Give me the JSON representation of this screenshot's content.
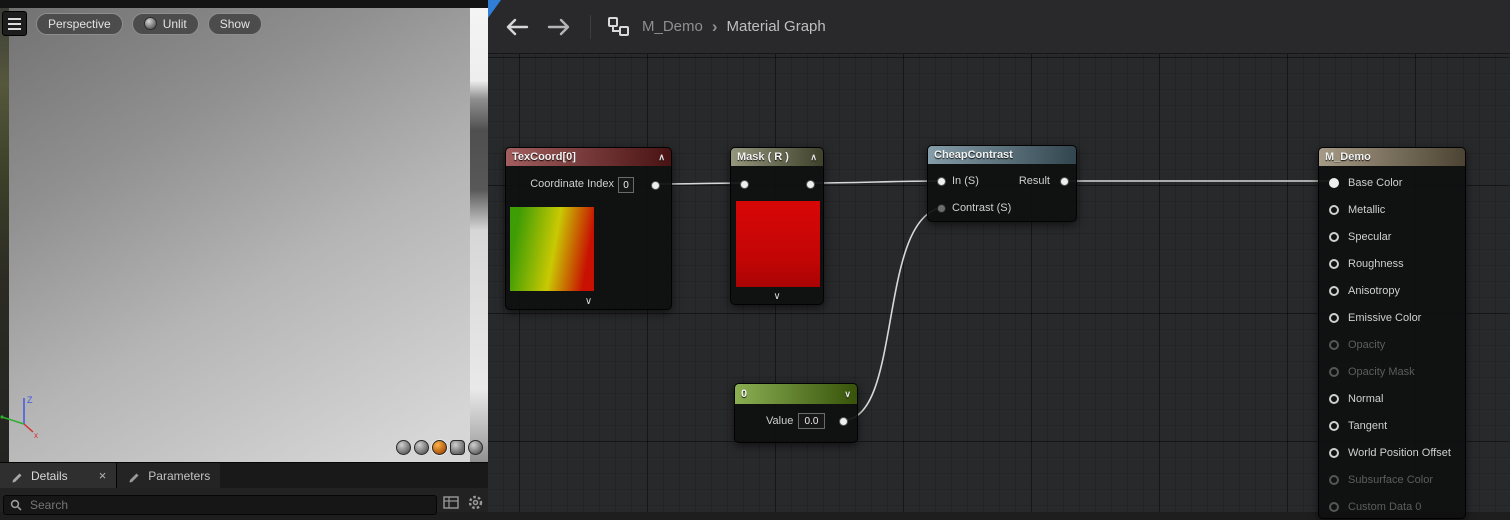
{
  "icons": {
    "close": "×",
    "chevron_up": "∧",
    "chevron_down": "∨",
    "breadcrumb_separator": "›"
  },
  "viewport": {
    "toolbar": {
      "perspective": "Perspective",
      "unlit": "Unlit",
      "show": "Show"
    },
    "gizmo_z_label": "Z",
    "gizmo_x_label": "x",
    "preview_meshes": [
      "cylinder",
      "sphere",
      "sphere (selected)",
      "cube",
      "custom mesh"
    ]
  },
  "bottom_panel": {
    "tabs": [
      {
        "label": "Details"
      },
      {
        "label": "Parameters"
      }
    ],
    "search_placeholder": "Search"
  },
  "graph": {
    "breadcrumb": {
      "root": "M_Demo",
      "current": "Material Graph"
    },
    "nodes": {
      "texcoord": {
        "title": "TexCoord[0]",
        "coordinate_index_label": "Coordinate Index",
        "coordinate_index_value": "0"
      },
      "mask": {
        "title": "Mask ( R )"
      },
      "cheap_contrast": {
        "title": "CheapContrast",
        "input_1": "In (S)",
        "input_2": "Contrast (S)",
        "output": "Result"
      },
      "scalar": {
        "title": "0",
        "value_label": "Value",
        "value": "0.0"
      },
      "material": {
        "title": "M_Demo",
        "pins": [
          {
            "label": "Base Color",
            "state": "connected"
          },
          {
            "label": "Metallic",
            "state": "enabled"
          },
          {
            "label": "Specular",
            "state": "enabled"
          },
          {
            "label": "Roughness",
            "state": "enabled"
          },
          {
            "label": "Anisotropy",
            "state": "enabled"
          },
          {
            "label": "Emissive Color",
            "state": "enabled"
          },
          {
            "label": "Opacity",
            "state": "disabled"
          },
          {
            "label": "Opacity Mask",
            "state": "disabled"
          },
          {
            "label": "Normal",
            "state": "enabled"
          },
          {
            "label": "Tangent",
            "state": "enabled"
          },
          {
            "label": "World Position Offset",
            "state": "enabled"
          },
          {
            "label": "Subsurface Color",
            "state": "disabled"
          },
          {
            "label": "Custom Data 0",
            "state": "disabled"
          }
        ]
      }
    },
    "colors": {
      "texcoord_header": "#7e2020",
      "mask_header": "#6b6f4a",
      "cheap_contrast_header": "#567888",
      "scalar_header": "#5e8f10",
      "material_header": "#837457",
      "wire": "#d8d8d8",
      "focus_accent": "#2f7fd6",
      "grid_background": "#28292b"
    }
  }
}
